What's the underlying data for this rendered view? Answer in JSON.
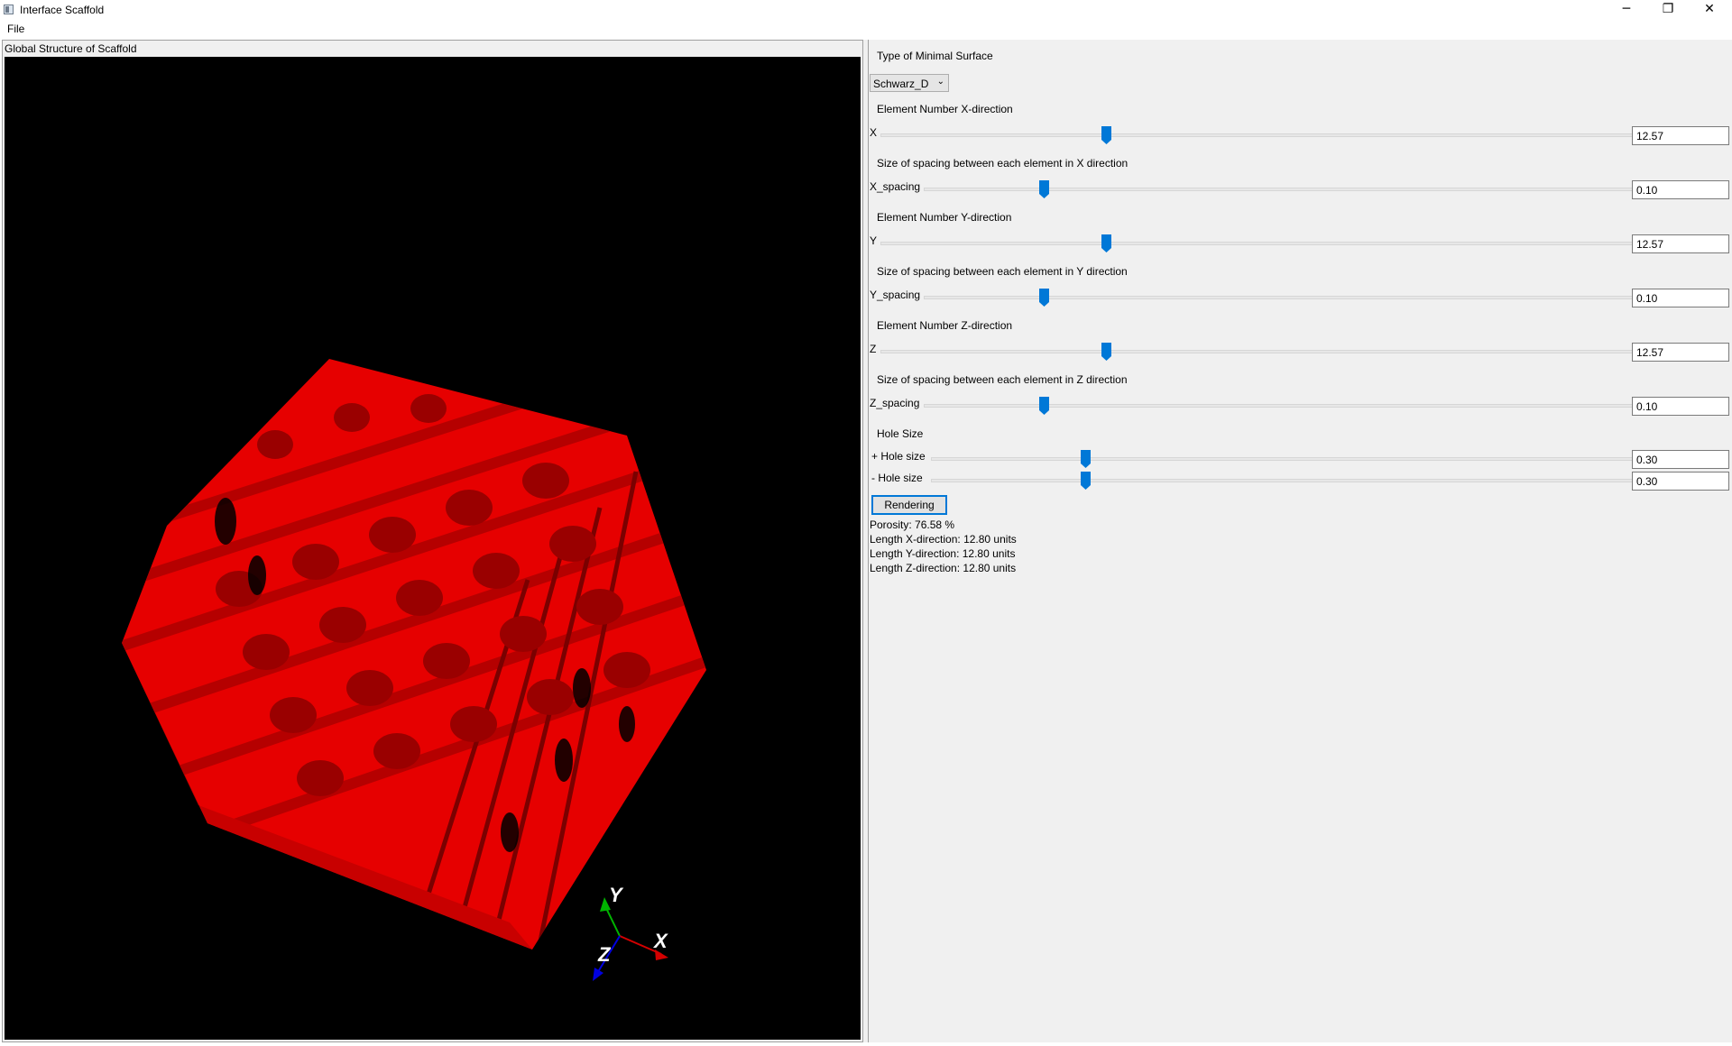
{
  "window": {
    "title": "Interface Scaffold",
    "minimize": "─",
    "maximize": "❐",
    "close": "✕"
  },
  "menu": {
    "file": "File"
  },
  "viewer": {
    "title": "Global Structure of Scaffold",
    "object_color": "#ff0000",
    "axes": {
      "x_label": "X",
      "y_label": "Y",
      "z_label": "Z",
      "x_color": "#d40000",
      "y_color": "#00b400",
      "z_color": "#0000e0"
    }
  },
  "controls": {
    "surface_type_label": "Type of Minimal Surface",
    "surface_type_value": "Schwarz_D",
    "x_heading": "Element Number X-direction",
    "x_label": "X",
    "x_value": "12.57",
    "x_position": 0.3,
    "xs_heading": "Size of spacing between each element in X direction",
    "xs_label": "X_spacing",
    "xs_value": "0.10",
    "xs_position": 0.17,
    "y_heading": "Element Number Y-direction",
    "y_label": "Y",
    "y_value": "12.57",
    "y_position": 0.3,
    "ys_heading": "Size of spacing between each element in Y direction",
    "ys_label": "Y_spacing",
    "ys_value": "0.10",
    "ys_position": 0.17,
    "z_heading": "Element Number Z-direction",
    "z_label": "Z",
    "z_value": "12.57",
    "z_position": 0.3,
    "zs_heading": "Size of spacing between each element in Z direction",
    "zs_label": "Z_spacing",
    "zs_value": "0.10",
    "zs_position": 0.17,
    "hole_heading": "Hole Size",
    "hole_plus_label": "+ Hole size",
    "hole_plus_value": "0.30",
    "hole_plus_position": 0.22,
    "hole_minus_label": "- Hole size",
    "hole_minus_value": "0.30",
    "hole_minus_position": 0.22,
    "render_button": "Rendering",
    "accent_color": "#0078d7"
  },
  "results": {
    "porosity": "Porosity: 76.58 %",
    "length_x": "Length X-direction: 12.80 units",
    "length_y": "Length Y-direction: 12.80 units",
    "length_z": "Length Z-direction: 12.80 units"
  }
}
